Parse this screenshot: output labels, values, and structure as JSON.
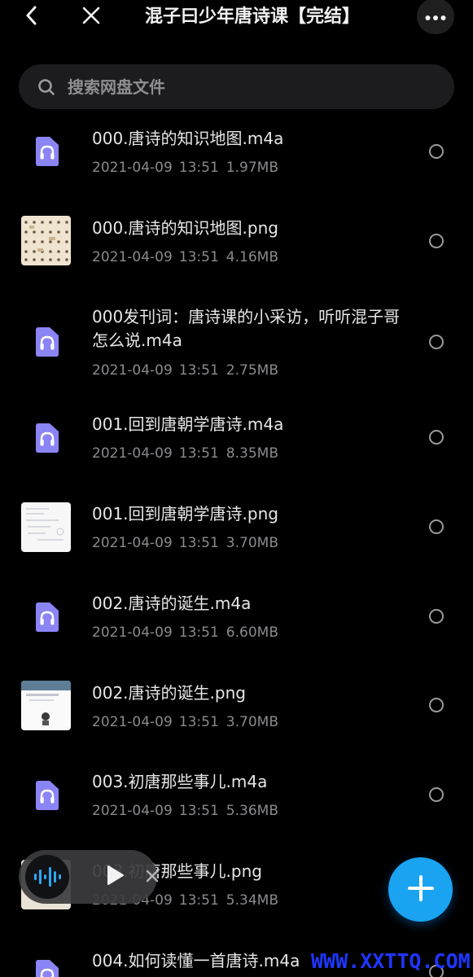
{
  "header": {
    "title": "混子曰少年唐诗课【完结】",
    "back_icon": "chevron-left-icon",
    "close_icon": "close-icon",
    "more_icon": "more-horizontal-icon"
  },
  "search": {
    "placeholder": "搜索网盘文件",
    "icon": "search-icon"
  },
  "files": [
    {
      "name": "000.唐诗的知识地图.m4a",
      "date": "2021-04-09",
      "time": "13:51",
      "size": "1.97MB",
      "type": "audio"
    },
    {
      "name": "000.唐诗的知识地图.png",
      "date": "2021-04-09",
      "time": "13:51",
      "size": "4.16MB",
      "type": "image"
    },
    {
      "name": "000发刊词：唐诗课的小采访，听听混子哥怎么说.m4a",
      "date": "2021-04-09",
      "time": "13:51",
      "size": "2.75MB",
      "type": "audio"
    },
    {
      "name": "001.回到唐朝学唐诗.m4a",
      "date": "2021-04-09",
      "time": "13:51",
      "size": "8.35MB",
      "type": "audio"
    },
    {
      "name": "001.回到唐朝学唐诗.png",
      "date": "2021-04-09",
      "time": "13:51",
      "size": "3.70MB",
      "type": "image"
    },
    {
      "name": "002.唐诗的诞生.m4a",
      "date": "2021-04-09",
      "time": "13:51",
      "size": "6.60MB",
      "type": "audio"
    },
    {
      "name": "002.唐诗的诞生.png",
      "date": "2021-04-09",
      "time": "13:51",
      "size": "3.70MB",
      "type": "image"
    },
    {
      "name": "003.初唐那些事儿.m4a",
      "date": "2021-04-09",
      "time": "13:51",
      "size": "5.36MB",
      "type": "audio"
    },
    {
      "name": "003.初唐那些事儿.png",
      "date": "2021-04-09",
      "time": "13:51",
      "size": "5.34MB",
      "type": "image"
    },
    {
      "name": "004.如何读懂一首唐诗.m4a",
      "date": "",
      "time": "",
      "size": "",
      "type": "audio"
    }
  ],
  "player": {
    "wave_icon": "audio-wave-icon",
    "play_icon": "play-icon",
    "close_icon": "close-icon"
  },
  "fab": {
    "icon": "plus-icon"
  },
  "watermark": {
    "text": "WWW.XXTTQ.COM"
  },
  "colors": {
    "background": "#000000",
    "audio_icon": "#8b84f5",
    "fab": "#1aa3f0",
    "watermark": "#1e36ff"
  }
}
